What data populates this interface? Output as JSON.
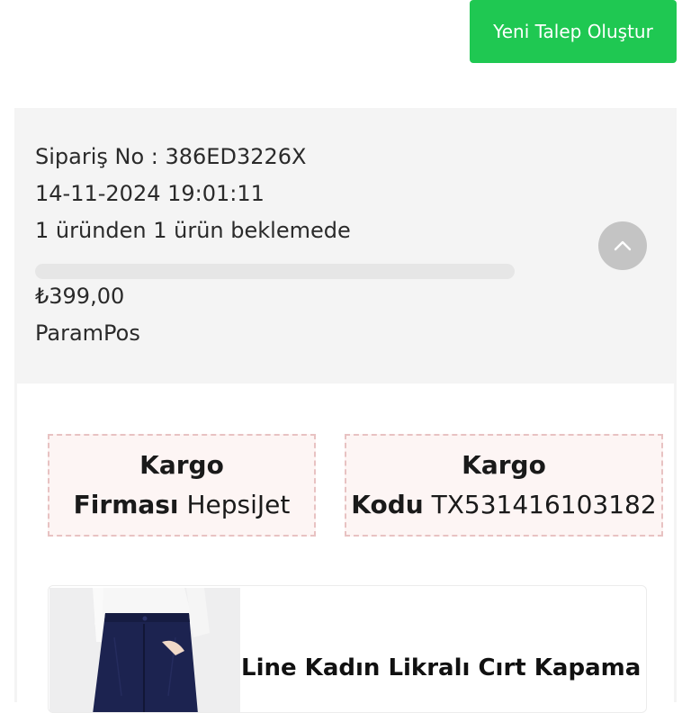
{
  "header": {
    "new_request_label": "Yeni Talep Oluştur",
    "accent_color": "#1fc852"
  },
  "order": {
    "order_no": "Sipariş No : 386ED3226X",
    "date": "14-11-2024 19:01:11",
    "status": "1 üründen 1 ürün beklemede",
    "progress": 0,
    "amount": "₺399,00",
    "payment_method": "ParamPos",
    "collapse_icon": "chevron-up-icon"
  },
  "cargo": {
    "firm_label_1": "Kargo",
    "firm_label_2": "Firması",
    "firm_value": "HepsiJet",
    "code_label_1": "Kargo",
    "code_label_2": "Kodu",
    "code_value": "TX531416103182"
  },
  "product": {
    "name": "Line Kadın Likralı Cırt Kapama"
  }
}
